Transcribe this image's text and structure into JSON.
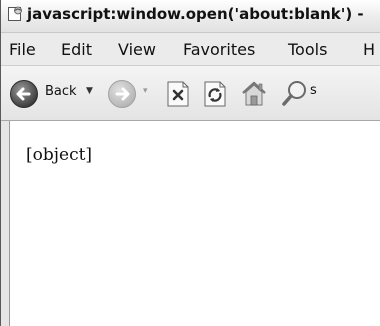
{
  "window": {
    "title": "javascript:window.open('about:blank') -"
  },
  "menu": {
    "items": [
      "File",
      "Edit",
      "View",
      "Favorites",
      "Tools",
      "H"
    ]
  },
  "toolbar": {
    "back_label": "Back",
    "icons": [
      "back-icon",
      "forward-icon",
      "stop-icon",
      "refresh-icon",
      "home-icon",
      "search-icon"
    ]
  },
  "content": {
    "text": "[object]"
  }
}
